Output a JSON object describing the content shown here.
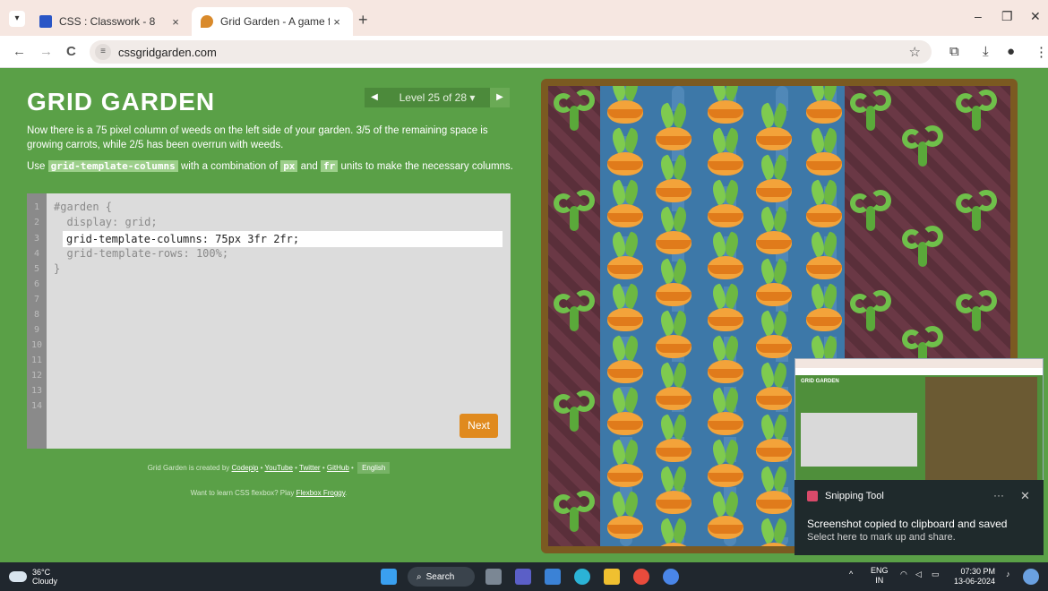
{
  "browser": {
    "tabs": [
      {
        "title": "CSS : Classwork - 8",
        "close": "×",
        "favicon_color": "#2a56c6"
      },
      {
        "title": "Grid Garden - A game for learni",
        "close": "×",
        "favicon_color": "#d98a2b"
      }
    ],
    "new_tab": "+",
    "window_controls": {
      "minimize": "–",
      "restore": "❐",
      "close": "✕"
    },
    "nav": {
      "back": "←",
      "forward": "→",
      "reload": "C"
    },
    "url": "cssgridgarden.com",
    "site_icon": "≡"
  },
  "page": {
    "title": "GRID GARDEN",
    "level": {
      "prev": "◀",
      "label": "Level 25 of 28 ▾",
      "next": "▶"
    },
    "description": "Now there is a 75 pixel column of weeds on the left side of your garden. 3/5 of the remaining space is growing carrots, while 2/5 has been overrun with weeds.",
    "instruction": {
      "pre": "Use",
      "kw1": "grid-template-columns",
      "mid": "with a combination of",
      "kw2": "px",
      "and": "and",
      "kw3": "fr",
      "post": "units to make the necessary columns."
    },
    "editor": {
      "line_numbers": [
        "1",
        "2",
        "3",
        "4",
        "5",
        "6",
        "7",
        "8",
        "9",
        "10",
        "11",
        "12",
        "13",
        "14"
      ],
      "lines": [
        "#garden {",
        "  display: grid;",
        "",
        "  grid-template-rows: 100%;",
        "}"
      ],
      "input_value": "grid-template-columns: 75px 3fr 2fr;",
      "next_label": "Next"
    },
    "credits": {
      "pre": "Grid Garden is created by",
      "codepip": "Codepip",
      "sep": "•",
      "youtube": "YouTube",
      "twitter": "Twitter",
      "github": "GitHub",
      "language": "English"
    },
    "froggy": {
      "pre": "Want to learn CSS flexbox? Play",
      "link": "Flexbox Froggy",
      "post": "."
    }
  },
  "notification": {
    "app": "Snipping Tool",
    "dots": "···",
    "close": "✕",
    "line1": "Screenshot copied to clipboard and saved",
    "line2": "Select here to mark up and share."
  },
  "thumbnail": {
    "title": "GRID GARDEN"
  },
  "taskbar": {
    "weather_temp": "36°C",
    "weather_text": "Cloudy",
    "search": "Search",
    "lang1": "ENG",
    "lang2": "IN",
    "time": "07:30 PM",
    "date": "13-06-2024",
    "tray_arrow": "^"
  },
  "colors": {
    "page_bg": "#5aa047",
    "weed_soil": "#5a2f3a",
    "water": "#3d78a8",
    "carrot": "#f3a33a",
    "accent": "#e08a1e"
  }
}
